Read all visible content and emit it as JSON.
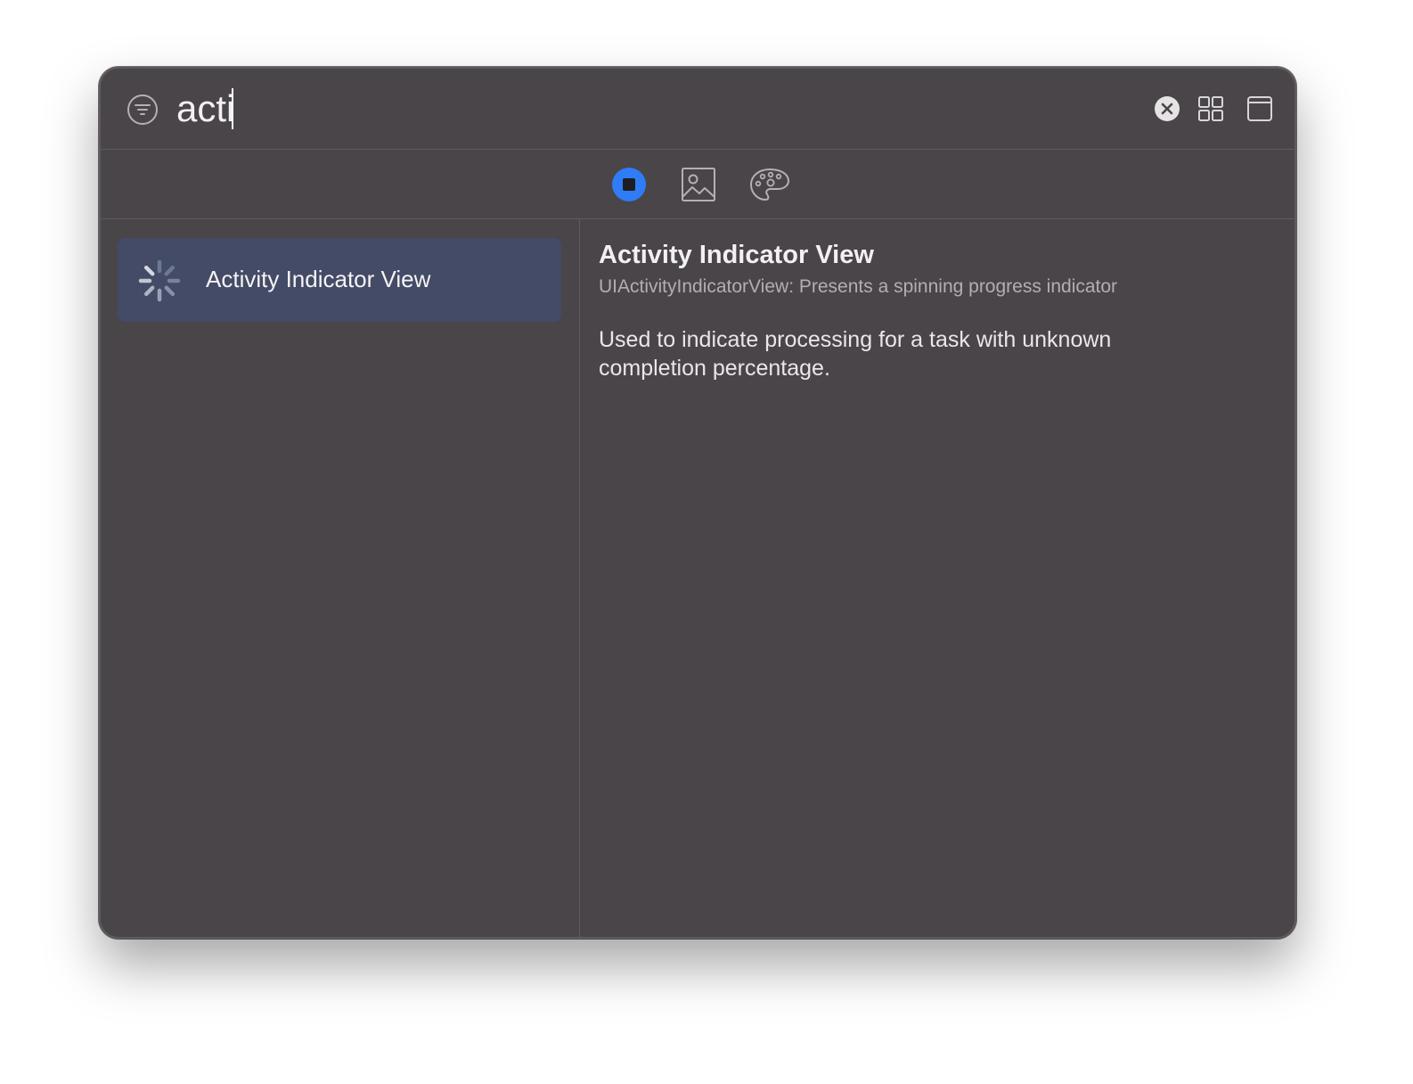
{
  "search": {
    "value": "acti",
    "icons": {
      "filter": "filter-icon",
      "clear": "clear-circle-icon",
      "grid": "grid-view-icon",
      "window": "window-icon"
    }
  },
  "tabs": [
    {
      "name": "objects",
      "icon": "square-in-circle-icon",
      "selected": true,
      "accent": "#2f7cf6"
    },
    {
      "name": "media",
      "icon": "photo-icon",
      "selected": false
    },
    {
      "name": "colors",
      "icon": "palette-icon",
      "selected": false
    }
  ],
  "sidebar": {
    "items": [
      {
        "label": "Activity Indicator View",
        "icon": "activity-spinner-icon",
        "selected": true
      }
    ]
  },
  "detail": {
    "title": "Activity Indicator View",
    "subtitle": "UIActivityIndicatorView: Presents a spinning progress indicator",
    "description": "Used to indicate processing for a task with unknown completion percentage."
  },
  "colors": {
    "window_bg": "#4a4548",
    "selection_bg": "#434b66",
    "accent": "#2f7cf6"
  }
}
